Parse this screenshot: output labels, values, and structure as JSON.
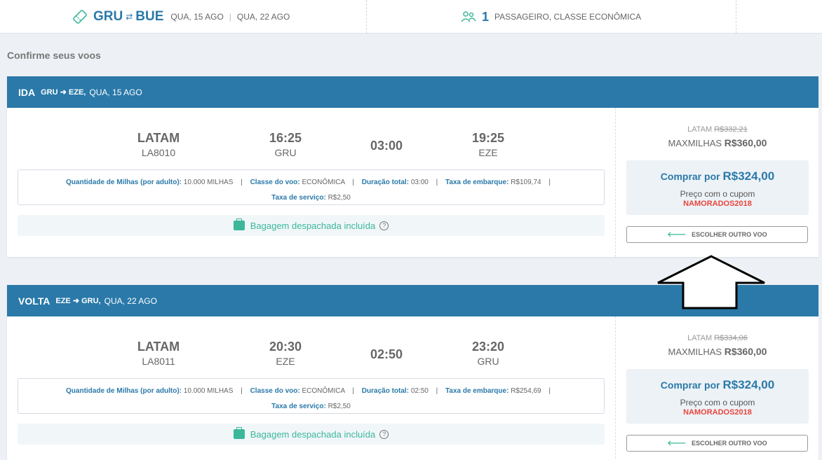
{
  "topbar": {
    "origin": "GRU",
    "destination": "BUE",
    "date_out": "QUA, 15 AGO",
    "date_back": "QUA, 22 AGO",
    "passengers": "1",
    "passenger_text": "PASSAGEIRO, CLASSE ECONÔMICA"
  },
  "confirm_title": "Confirme seus voos",
  "flights": [
    {
      "direction": "IDA",
      "route": "GRU ➜ EZE,",
      "date": "QUA, 15 AGO",
      "airline": "LATAM",
      "flight_no": "LA8010",
      "dep_time": "16:25",
      "dep_airport": "GRU",
      "duration": "03:00",
      "arr_time": "19:25",
      "arr_airport": "EZE",
      "miles_label": "Quantidade de Milhas (por adulto):",
      "miles_value": "10.000 MILHAS",
      "class_label": "Classe do voo:",
      "class_value": "ECONÔMICA",
      "duration_label": "Duração total:",
      "duration_value": "03:00",
      "boarding_label": "Taxa de embarque:",
      "boarding_value": "R$109,74",
      "service_label": "Taxa de serviço:",
      "service_value": "R$2,50",
      "bag_text": "Bagagem despachada incluída",
      "latam_label": "LATAM",
      "latam_price": "R$332,21",
      "max_label": "MAXMILHAS",
      "max_price": "R$360,00",
      "buy_label": "Comprar por",
      "buy_price": "R$324,00",
      "coupon_text": "Preço com o cupom",
      "coupon_code": "NAMORADOS2018",
      "other_label": "ESCOLHER OUTRO VOO"
    },
    {
      "direction": "VOLTA",
      "route": "EZE ➜ GRU,",
      "date": "QUA, 22 AGO",
      "airline": "LATAM",
      "flight_no": "LA8011",
      "dep_time": "20:30",
      "dep_airport": "EZE",
      "duration": "02:50",
      "arr_time": "23:20",
      "arr_airport": "GRU",
      "miles_label": "Quantidade de Milhas (por adulto):",
      "miles_value": "10.000 MILHAS",
      "class_label": "Classe do voo:",
      "class_value": "ECONÔMICA",
      "duration_label": "Duração total:",
      "duration_value": "02:50",
      "boarding_label": "Taxa de embarque:",
      "boarding_value": "R$254,69",
      "service_label": "Taxa de serviço:",
      "service_value": "R$2,50",
      "bag_text": "Bagagem despachada incluída",
      "latam_label": "LATAM",
      "latam_price": "R$334,06",
      "max_label": "MAXMILHAS",
      "max_price": "R$360,00",
      "buy_label": "Comprar por",
      "buy_price": "R$324,00",
      "coupon_text": "Preço com o cupom",
      "coupon_code": "NAMORADOS2018",
      "other_label": "ESCOLHER OUTRO VOO"
    }
  ],
  "colors": {
    "primary": "#2a79a9",
    "accent_green": "#3bb89a",
    "coupon_red": "#e9453f",
    "background": "#edf1f6"
  }
}
